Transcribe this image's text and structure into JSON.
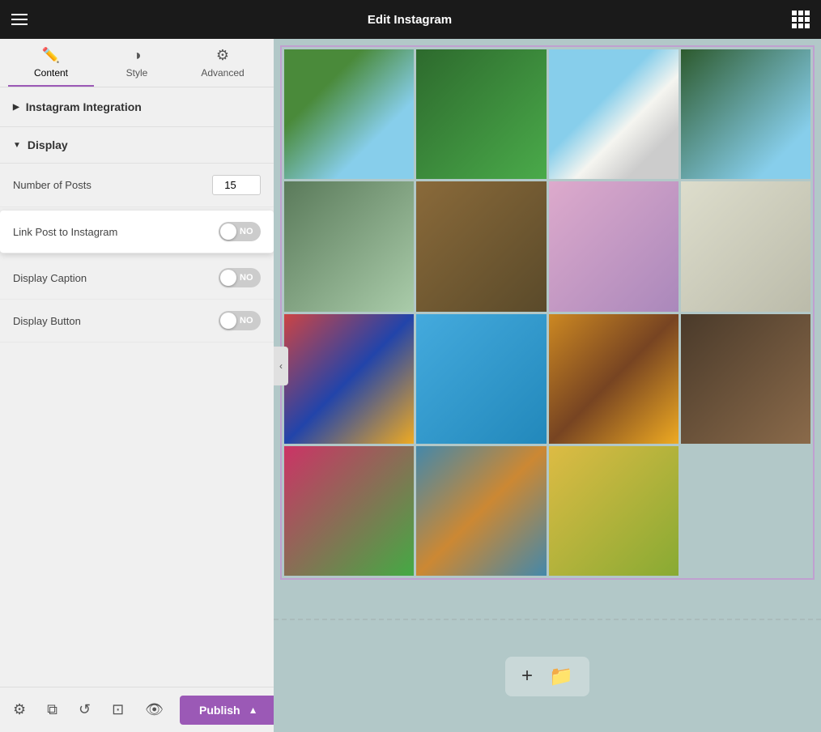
{
  "topbar": {
    "title": "Edit Instagram",
    "hamburger_label": "menu",
    "grid_label": "apps"
  },
  "tabs": [
    {
      "id": "content",
      "label": "Content",
      "icon": "✏️",
      "active": true
    },
    {
      "id": "style",
      "label": "Style",
      "icon": "◑"
    },
    {
      "id": "advanced",
      "label": "Advanced",
      "icon": "⚙️"
    }
  ],
  "sidebar": {
    "instagram_integration": {
      "label": "Instagram Integration",
      "expanded": false
    },
    "display_section": {
      "label": "Display",
      "expanded": true
    },
    "settings": {
      "number_of_posts": {
        "label": "Number of Posts",
        "value": "15"
      },
      "link_post": {
        "label": "Link Post to Instagram",
        "value": "NO",
        "enabled": false
      },
      "display_caption": {
        "label": "Display Caption",
        "value": "NO",
        "enabled": false
      },
      "display_button": {
        "label": "Display Button",
        "value": "NO",
        "enabled": false
      }
    }
  },
  "toolbar": {
    "settings_icon": "settings",
    "layers_icon": "layers",
    "history_icon": "history",
    "responsive_icon": "responsive",
    "eye_icon": "eye",
    "publish_label": "Publish",
    "chevron_icon": "chevron-up"
  },
  "canvas": {
    "collapse_icon": "‹",
    "bottom_plus_icon": "+",
    "bottom_folder_icon": "📁"
  }
}
